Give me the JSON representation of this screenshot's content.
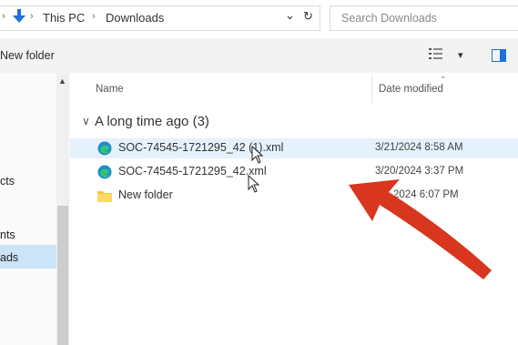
{
  "address": {
    "this_pc": "This PC",
    "sep": "›",
    "downloads": "Downloads",
    "dropdown": "⌄",
    "refresh": "↻"
  },
  "search": {
    "placeholder": "Search Downloads"
  },
  "toolbar": {
    "new_folder": "New folder",
    "view_chevron": "▾"
  },
  "sidebar": {
    "items": [
      {
        "label": "cts"
      },
      {
        "label": "nts"
      },
      {
        "label": "ads",
        "selected": true
      }
    ],
    "scroll_up": "▲"
  },
  "columns": {
    "name": "Name",
    "date_modified": "Date modified",
    "sort_caret": "⌄"
  },
  "group": {
    "chevron": "∨",
    "label": "A long time ago (3)"
  },
  "files": [
    {
      "name": "SOC-74545-1721295_42 (1).xml",
      "date": "3/21/2024 8:58 AM",
      "icon": "edge-icon",
      "selected": true
    },
    {
      "name": "SOC-74545-1721295_42.xml",
      "date": "3/20/2024 3:37 PM",
      "icon": "edge-icon",
      "selected": false
    },
    {
      "name": "New folder",
      "date": "2024 6:07 PM",
      "icon": "folder-icon",
      "selected": false
    }
  ],
  "annotation": {
    "color": "#d8361e",
    "icon": "red-arrow-icon"
  },
  "colors": {
    "selection": "#e5f1fb",
    "sidebar_selection": "#cce4f7",
    "accent": "#1e6fd9"
  }
}
